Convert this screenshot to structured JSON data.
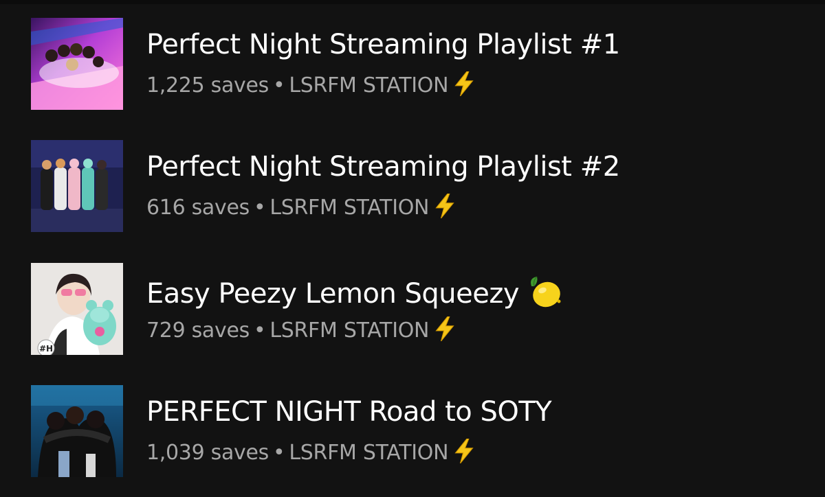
{
  "colors": {
    "background": "#121212",
    "title": "#ffffff",
    "subtitle": "#a7a7a7",
    "bolt": "#f5c518"
  },
  "playlists": [
    {
      "title": "Perfect Night Streaming Playlist #1",
      "saves": "1,225 saves",
      "separator": "•",
      "owner": "LSRFM STATION",
      "owner_icon": "lightning-bolt-icon"
    },
    {
      "title": "Perfect Night Streaming Playlist #2",
      "saves": "616 saves",
      "separator": "•",
      "owner": "LSRFM STATION",
      "owner_icon": "lightning-bolt-icon"
    },
    {
      "title": "Easy Peezy Lemon Squeezy",
      "title_icon": "lemon-icon",
      "saves": "729 saves",
      "separator": "•",
      "owner": "LSRFM STATION",
      "owner_icon": "lightning-bolt-icon",
      "cover_badge": "#H"
    },
    {
      "title": "PERFECT NIGHT Road to SOTY",
      "saves": "1,039 saves",
      "separator": "•",
      "owner": "LSRFM STATION",
      "owner_icon": "lightning-bolt-icon"
    }
  ]
}
